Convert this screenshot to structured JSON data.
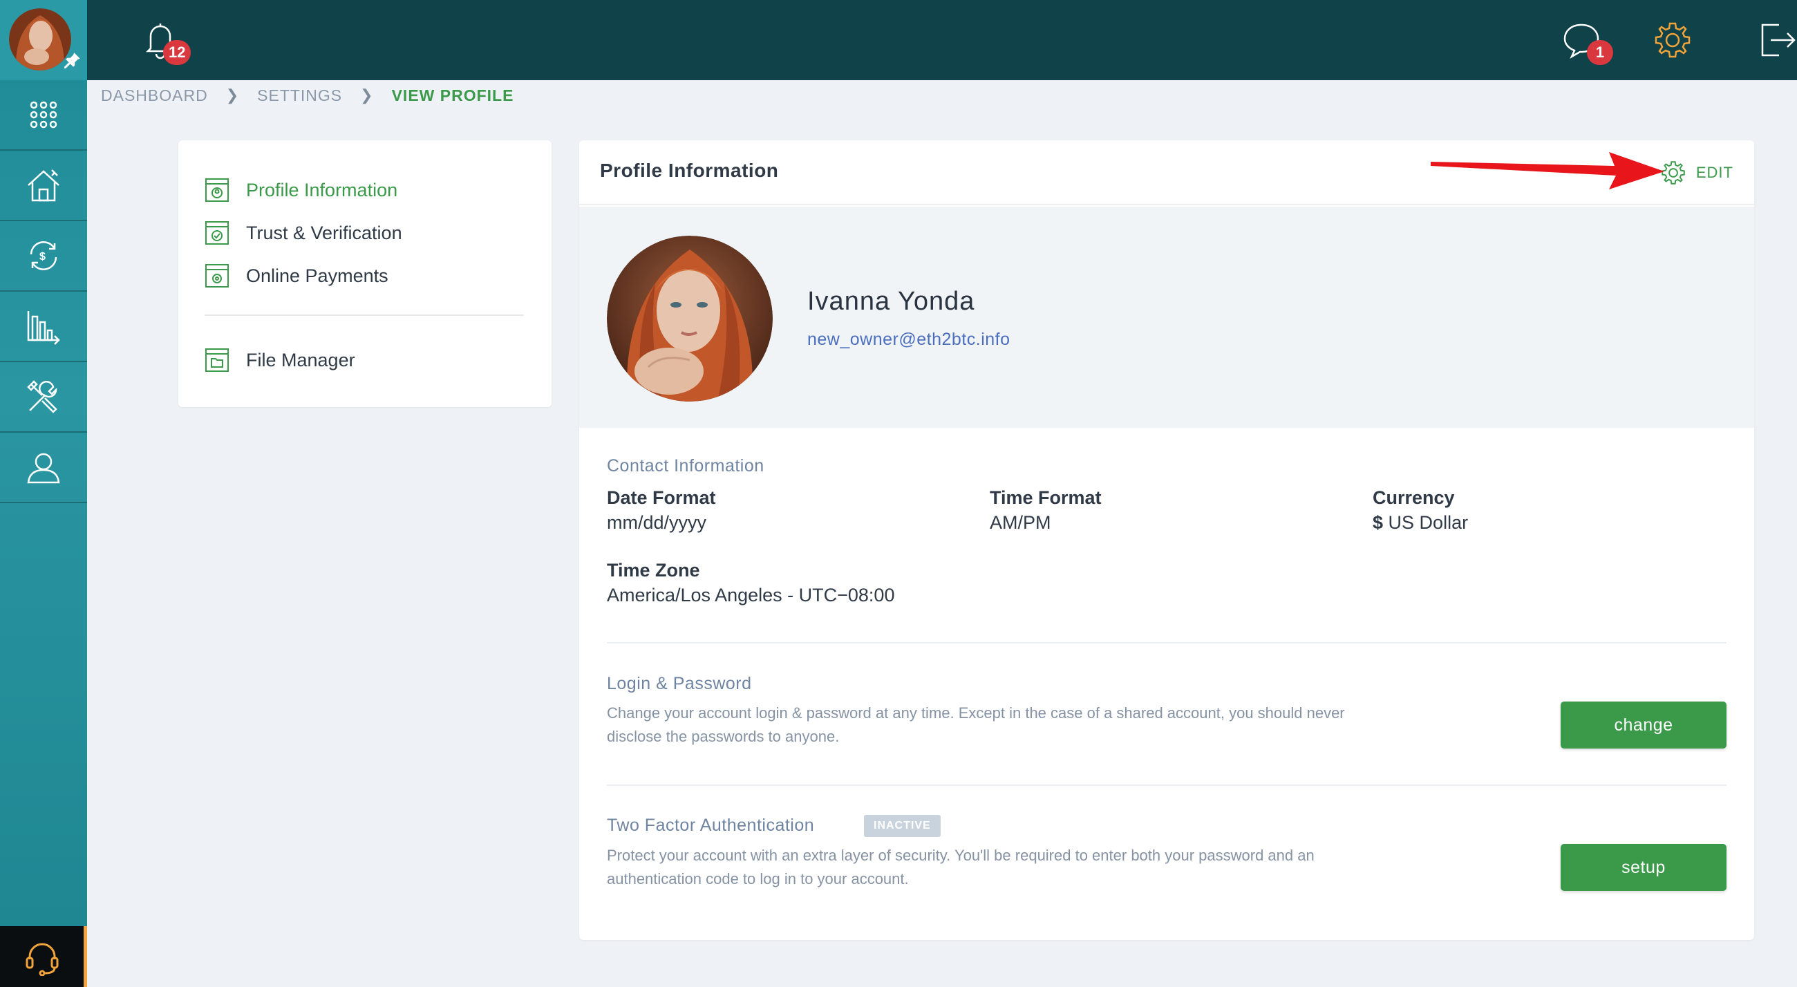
{
  "topbar": {
    "notifications_count": "12",
    "messages_count": "1"
  },
  "breadcrumb": {
    "items": [
      "DASHBOARD",
      "SETTINGS",
      "VIEW PROFILE"
    ]
  },
  "sidebar": {
    "items": [
      {
        "icon": "apps-grid-icon"
      },
      {
        "icon": "home-key-icon"
      },
      {
        "icon": "currency-exchange-icon"
      },
      {
        "icon": "bar-chart-icon"
      },
      {
        "icon": "tools-icon"
      },
      {
        "icon": "user-icon"
      }
    ],
    "support_icon": "headset-icon"
  },
  "settings_menu": {
    "items": [
      {
        "label": "Profile Information",
        "icon": "profile-window-icon",
        "active": true
      },
      {
        "label": "Trust & Verification",
        "icon": "check-window-icon",
        "active": false
      },
      {
        "label": "Online Payments",
        "icon": "gear-window-icon",
        "active": false
      }
    ],
    "file_manager": {
      "label": "File Manager",
      "icon": "folder-window-icon"
    }
  },
  "profile": {
    "card_title": "Profile Information",
    "edit_label": "EDIT",
    "name": "Ivanna Yonda",
    "email": "new_owner@eth2btc.info"
  },
  "contact": {
    "title": "Contact Information",
    "date_format_label": "Date Format",
    "date_format_value": "mm/dd/yyyy",
    "time_format_label": "Time Format",
    "time_format_value": "AM/PM",
    "currency_label": "Currency",
    "currency_symbol": "$",
    "currency_value": "US Dollar",
    "time_zone_label": "Time Zone",
    "time_zone_value": "America/Los Angeles - UTC−08:00"
  },
  "login": {
    "title": "Login & Password",
    "description": "Change your account login & password at any time. Except in the case of a shared account, you should never disclose the passwords to anyone.",
    "button": "change"
  },
  "two_factor": {
    "title": "Two Factor Authentication",
    "status": "INACTIVE",
    "description": "Protect your account with an extra layer of security. You'll be required to enter both your password and an authentication code to log in to your account.",
    "button": "setup"
  },
  "colors": {
    "accent_green": "#3a9a49",
    "topbar": "#0f4349",
    "sidebar": "#2a96a2",
    "badge_red": "#d9383e",
    "settings_orange": "#f2a33a"
  }
}
